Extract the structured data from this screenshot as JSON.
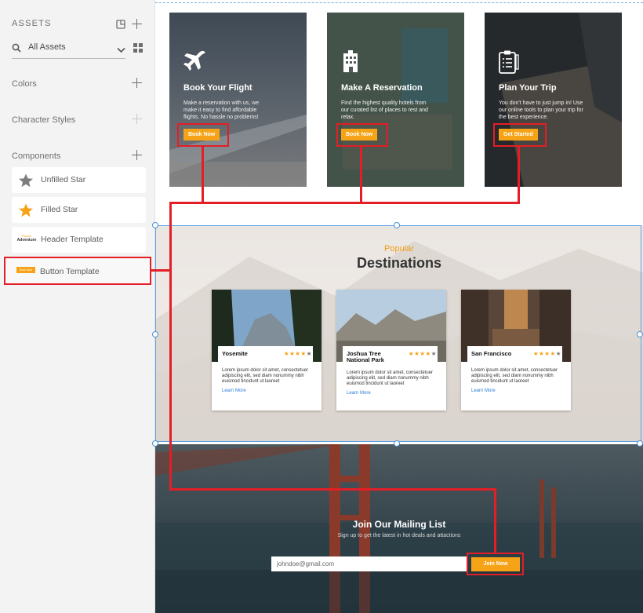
{
  "sidebar": {
    "title": "ASSETS",
    "search_label": "All Assets",
    "sections": {
      "colors": "Colors",
      "character_styles": "Character Styles",
      "components": "Components"
    },
    "components": [
      {
        "label": "Unfilled Star",
        "icon": "star-outline-icon"
      },
      {
        "label": "Filled Star",
        "icon": "star-icon"
      },
      {
        "label": "Header Template",
        "thumb_small": "Popular",
        "thumb_large": "Adventure"
      },
      {
        "label": "Button Template",
        "thumb_text": "Book Now"
      }
    ]
  },
  "cards": [
    {
      "title": "Book Your Flight",
      "body": "Make a reservation with us, we make it easy to find affordable flights. No hassle no problems!",
      "cta": "Book Now",
      "icon": "airplane-icon"
    },
    {
      "title": "Make A Reservation",
      "body": "Find the highest quality hotels from our curated list of places to rest and relax.",
      "cta": "Book Now",
      "icon": "hotel-icon"
    },
    {
      "title": "Plan Your Trip",
      "body": "You don't have to just jump in! Use our online tools to plan your trip for the best experience.",
      "cta": "Get Started",
      "icon": "checklist-icon"
    }
  ],
  "destinations": {
    "kicker": "Popular",
    "headline": "Destinations",
    "items": [
      {
        "name": "Yosemite",
        "stars": 4,
        "body": "Lorem ipsum dolor sit amet, consectetuer adipiscing elit, sed diam nonummy nibh euismod tincidunt ut laoreet",
        "link": "Learn More"
      },
      {
        "name": "Joshua Tree National Park",
        "stars": 4,
        "body": "Lorem ipsum dolor sit amet, consectetuer adipiscing elit, sed diam nonummy nibh euismod tincidunt ut laoreet",
        "link": "Learn More"
      },
      {
        "name": "San Francisco",
        "stars": 4,
        "body": "Lorem ipsum dolor sit amet, consectetuer adipiscing elit, sed diam nonummy nibh euismod tincidunt ut laoreet",
        "link": "Learn More"
      }
    ]
  },
  "mailing": {
    "title": "Join Our Mailing List",
    "subtitle": "Sign up to get the latest in hot deals and attactions",
    "email_value": "johndoe@gmail.com",
    "button": "Join Now"
  },
  "colors": {
    "accent": "#f6a317",
    "annotation": "#e41e26",
    "selection": "#5fa0e4"
  }
}
